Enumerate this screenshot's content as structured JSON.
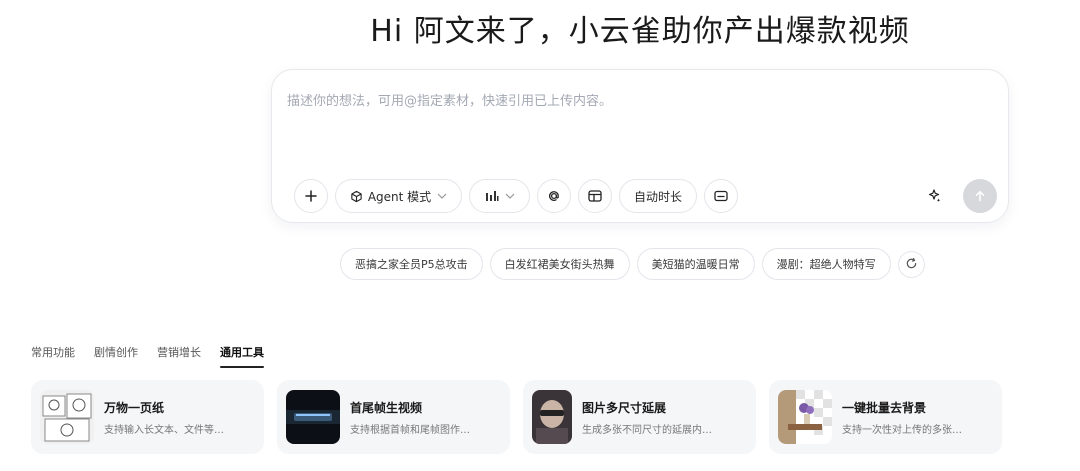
{
  "hero": {
    "title": "Hi 阿文来了，小云雀助你产出爆款视频"
  },
  "prompt": {
    "placeholder": "描述你的想法，可用@指定素材，快速引用已上传内容。",
    "toolbar": {
      "add_icon": "plus-icon",
      "agent_label": "Agent 模式",
      "agent_icon": "cube-icon",
      "chart_icon": "bar-chart-icon",
      "mention_icon": "at-icon",
      "layout_icon": "layout-icon",
      "duration_label": "自动时长",
      "caption_icon": "subtitle-icon",
      "magic_icon": "sparkle-icon",
      "send_icon": "arrow-up-icon"
    }
  },
  "suggestions": [
    {
      "label": "恶搞之家全员P5总攻击"
    },
    {
      "label": "白发红裙美女街头热舞"
    },
    {
      "label": "美短猫的温暖日常"
    },
    {
      "label": "漫剧：超绝人物特写"
    }
  ],
  "tabs": [
    {
      "label": "常用功能"
    },
    {
      "label": "剧情创作"
    },
    {
      "label": "营销增长"
    },
    {
      "label": "通用工具"
    }
  ],
  "active_tab": "通用工具",
  "cards": [
    {
      "title": "万物一页纸",
      "desc": "支持输入长文本、文件等…"
    },
    {
      "title": "首尾帧生视频",
      "desc": "支持根据首帧和尾帧图作…"
    },
    {
      "title": "图片多尺寸延展",
      "desc": "生成多张不同尺寸的延展内…"
    },
    {
      "title": "一键批量去背景",
      "desc": "支持一次性对上传的多张…"
    }
  ],
  "colors": {
    "accent": "#1a1a1a",
    "send_disabled": "#d6d8dc",
    "card_bg": "#f5f6f8"
  }
}
